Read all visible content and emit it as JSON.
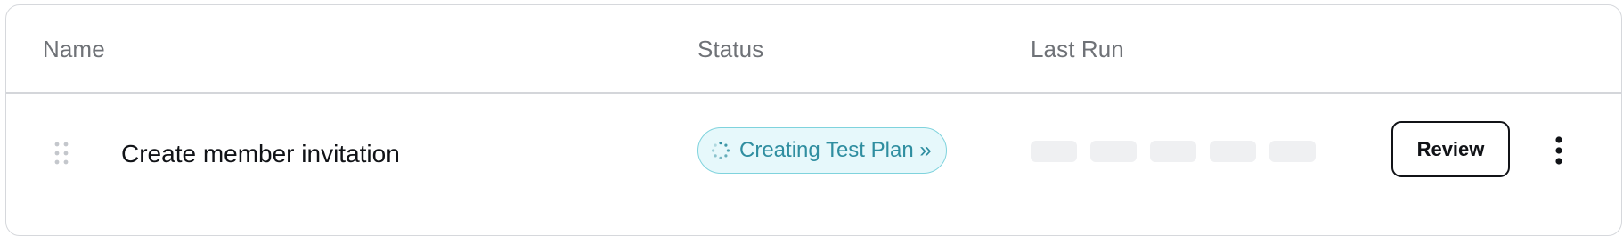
{
  "table": {
    "columns": {
      "name": "Name",
      "status": "Status",
      "last_run": "Last Run"
    },
    "rows": [
      {
        "name": "Create member invitation",
        "status": {
          "label": "Creating Test Plan »",
          "icon": "spinner-icon",
          "color": "#2f8ea0",
          "background": "#e6f8fb",
          "border": "#7fd3dd"
        },
        "last_run": "loading",
        "actions": {
          "review_label": "Review",
          "more_icon": "more-vertical-icon"
        }
      }
    ]
  }
}
